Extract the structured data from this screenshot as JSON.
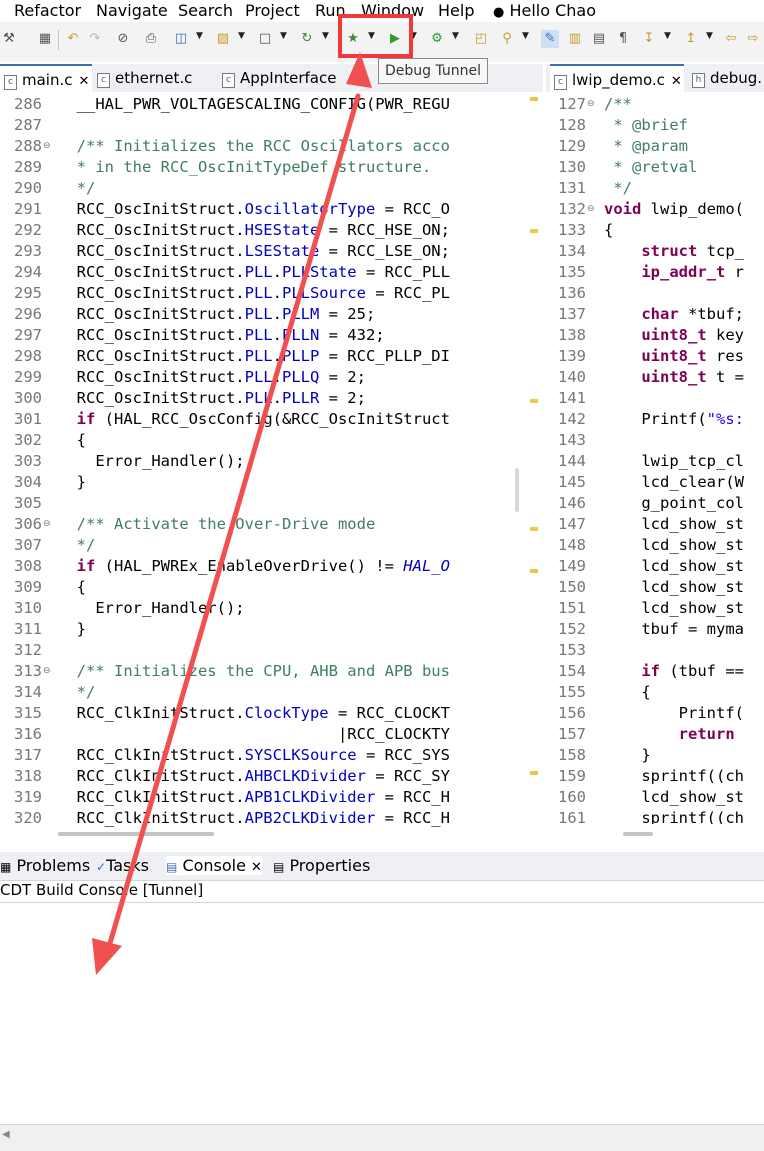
{
  "menu": {
    "items": [
      "Refactor",
      "Navigate",
      "Search",
      "Project",
      "Run",
      "Window",
      "Help"
    ],
    "user": "Hello Chao"
  },
  "tooltip": "Debug Tunnel",
  "editor_left": {
    "tabs": [
      {
        "label": "main.c",
        "active": true,
        "closable": true
      },
      {
        "label": "ethernet.c",
        "active": false,
        "closable": false
      },
      {
        "label": "AppInterface",
        "active": false,
        "closable": false
      }
    ],
    "lines": [
      {
        "num": "286",
        "code": "  __HAL_PWR_VOLTAGESCALING_CONFIG(PWR_REGU"
      },
      {
        "num": "287",
        "code": ""
      },
      {
        "num": "288",
        "code": "  /** Initializes the RCC Oscillators acco"
      },
      {
        "num": "289",
        "code": "  * in the RCC_OscInitTypeDef structure."
      },
      {
        "num": "290",
        "code": "  */"
      },
      {
        "num": "291",
        "code": "  RCC_OscInitStruct.OscillatorType = RCC_O"
      },
      {
        "num": "292",
        "code": "  RCC_OscInitStruct.HSEState = RCC_HSE_ON;"
      },
      {
        "num": "293",
        "code": "  RCC_OscInitStruct.LSEState = RCC_LSE_ON;"
      },
      {
        "num": "294",
        "code": "  RCC_OscInitStruct.PLL.PLLState = RCC_PLL"
      },
      {
        "num": "295",
        "code": "  RCC_OscInitStruct.PLL.PLLSource = RCC_PL"
      },
      {
        "num": "296",
        "code": "  RCC_OscInitStruct.PLL.PLLM = 25;"
      },
      {
        "num": "297",
        "code": "  RCC_OscInitStruct.PLL.PLLN = 432;"
      },
      {
        "num": "298",
        "code": "  RCC_OscInitStruct.PLL.PLLP = RCC_PLLP_DI"
      },
      {
        "num": "299",
        "code": "  RCC_OscInitStruct.PLL.PLLQ = 2;"
      },
      {
        "num": "300",
        "code": "  RCC_OscInitStruct.PLL.PLLR = 2;"
      },
      {
        "num": "301",
        "code": "  if (HAL_RCC_OscConfig(&RCC_OscInitStruct"
      },
      {
        "num": "302",
        "code": "  {"
      },
      {
        "num": "303",
        "code": "    Error_Handler();"
      },
      {
        "num": "304",
        "code": "  }"
      },
      {
        "num": "305",
        "code": ""
      },
      {
        "num": "306",
        "code": "  /** Activate the Over-Drive mode"
      },
      {
        "num": "307",
        "code": "  */"
      },
      {
        "num": "308",
        "code": "  if (HAL_PWREx_EnableOverDrive() != HAL_O"
      },
      {
        "num": "309",
        "code": "  {"
      },
      {
        "num": "310",
        "code": "    Error_Handler();"
      },
      {
        "num": "311",
        "code": "  }"
      },
      {
        "num": "312",
        "code": ""
      },
      {
        "num": "313",
        "code": "  /** Initializes the CPU, AHB and APB bus"
      },
      {
        "num": "314",
        "code": "  */"
      },
      {
        "num": "315",
        "code": "  RCC_ClkInitStruct.ClockType = RCC_CLOCKT"
      },
      {
        "num": "316",
        "code": "                              |RCC_CLOCKTY"
      },
      {
        "num": "317",
        "code": "  RCC_ClkInitStruct.SYSCLKSource = RCC_SYS"
      },
      {
        "num": "318",
        "code": "  RCC_ClkInitStruct.AHBCLKDivider = RCC_SY"
      },
      {
        "num": "319",
        "code": "  RCC_ClkInitStruct.APB1CLKDivider = RCC_H"
      },
      {
        "num": "320",
        "code": "  RCC_ClkInitStruct.APB2CLKDivider = RCC_H"
      }
    ]
  },
  "editor_right": {
    "tabs": [
      {
        "label": "lwip_demo.c",
        "active": true,
        "closable": true
      },
      {
        "label": "debug.",
        "active": false,
        "closable": false
      }
    ],
    "lines": [
      {
        "num": "127",
        "code": "/**"
      },
      {
        "num": "128",
        "code": " * @brief"
      },
      {
        "num": "129",
        "code": " * @param"
      },
      {
        "num": "130",
        "code": " * @retval"
      },
      {
        "num": "131",
        "code": " */"
      },
      {
        "num": "132",
        "code": "void lwip_demo("
      },
      {
        "num": "133",
        "code": "{"
      },
      {
        "num": "134",
        "code": "    struct tcp_"
      },
      {
        "num": "135",
        "code": "    ip_addr_t r"
      },
      {
        "num": "136",
        "code": ""
      },
      {
        "num": "137",
        "code": "    char *tbuf;"
      },
      {
        "num": "138",
        "code": "    uint8_t key"
      },
      {
        "num": "139",
        "code": "    uint8_t res"
      },
      {
        "num": "140",
        "code": "    uint8_t t ="
      },
      {
        "num": "141",
        "code": ""
      },
      {
        "num": "142",
        "code": "    Printf(\"%s:"
      },
      {
        "num": "143",
        "code": ""
      },
      {
        "num": "144",
        "code": "    lwip_tcp_cl"
      },
      {
        "num": "145",
        "code": "    lcd_clear(W"
      },
      {
        "num": "146",
        "code": "    g_point_col"
      },
      {
        "num": "147",
        "code": "    lcd_show_st"
      },
      {
        "num": "148",
        "code": "    lcd_show_st"
      },
      {
        "num": "149",
        "code": "    lcd_show_st"
      },
      {
        "num": "150",
        "code": "    lcd_show_st"
      },
      {
        "num": "151",
        "code": "    lcd_show_st"
      },
      {
        "num": "152",
        "code": "    tbuf = myma"
      },
      {
        "num": "153",
        "code": ""
      },
      {
        "num": "154",
        "code": "    if (tbuf =="
      },
      {
        "num": "155",
        "code": "    {"
      },
      {
        "num": "156",
        "code": "        Printf("
      },
      {
        "num": "157",
        "code": "        return"
      },
      {
        "num": "158",
        "code": "    }"
      },
      {
        "num": "159",
        "code": "    sprintf((ch"
      },
      {
        "num": "160",
        "code": "    lcd_show_st"
      },
      {
        "num": "161",
        "code": "    sprintf((ch"
      }
    ]
  },
  "bottom_panel": {
    "tabs": [
      "Problems",
      "Tasks",
      "Console",
      "Properties"
    ],
    "active_tab": "Console",
    "console_title": "CDT Build Console [Tunnel]"
  },
  "colors": {
    "keyword": "#7f0055",
    "comment": "#3f7f5f",
    "field": "#0000c0",
    "string": "#2a00ff",
    "annotation": "#f03a3a"
  }
}
